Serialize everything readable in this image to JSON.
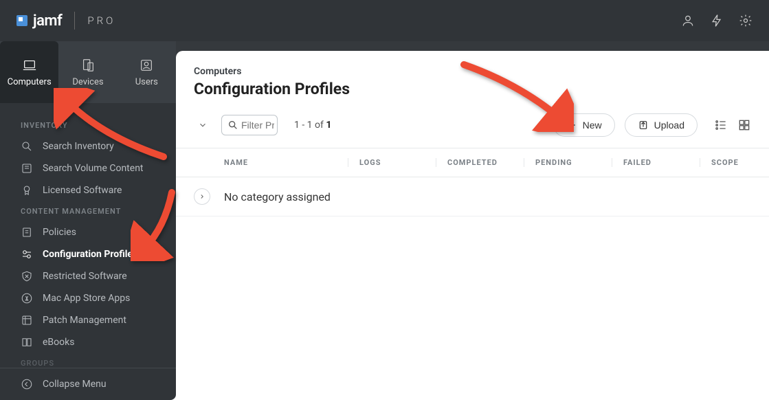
{
  "brand": {
    "name": "jamf",
    "edition": "PRO"
  },
  "nav_tabs": [
    {
      "label": "Computers",
      "icon": "laptop",
      "active": true
    },
    {
      "label": "Devices",
      "icon": "devices",
      "active": false
    },
    {
      "label": "Users",
      "icon": "users",
      "active": false
    }
  ],
  "sidebar": {
    "groups": [
      {
        "label": "INVENTORY",
        "items": [
          {
            "label": "Search Inventory",
            "icon": "search"
          },
          {
            "label": "Search Volume Content",
            "icon": "volume"
          },
          {
            "label": "Licensed Software",
            "icon": "license"
          }
        ]
      },
      {
        "label": "CONTENT MANAGEMENT",
        "items": [
          {
            "label": "Policies",
            "icon": "policy"
          },
          {
            "label": "Configuration Profiles",
            "icon": "config",
            "active": true
          },
          {
            "label": "Restricted Software",
            "icon": "restricted"
          },
          {
            "label": "Mac App Store Apps",
            "icon": "appstore"
          },
          {
            "label": "Patch Management",
            "icon": "patch"
          },
          {
            "label": "eBooks",
            "icon": "ebook"
          }
        ]
      },
      {
        "label": "GROUPS",
        "items": []
      }
    ],
    "collapse_label": "Collapse Menu"
  },
  "main": {
    "breadcrumb": "Computers",
    "title": "Configuration Profiles",
    "filter_placeholder": "Filter Pr",
    "range_text": "1 - 1 of ",
    "range_total": "1",
    "buttons": {
      "new": "New",
      "upload": "Upload"
    },
    "columns": {
      "name": "NAME",
      "logs": "LOGS",
      "completed": "COMPLETED",
      "pending": "PENDING",
      "failed": "FAILED",
      "scope": "SCOPE"
    },
    "rows": [
      {
        "label": "No category assigned"
      }
    ]
  }
}
